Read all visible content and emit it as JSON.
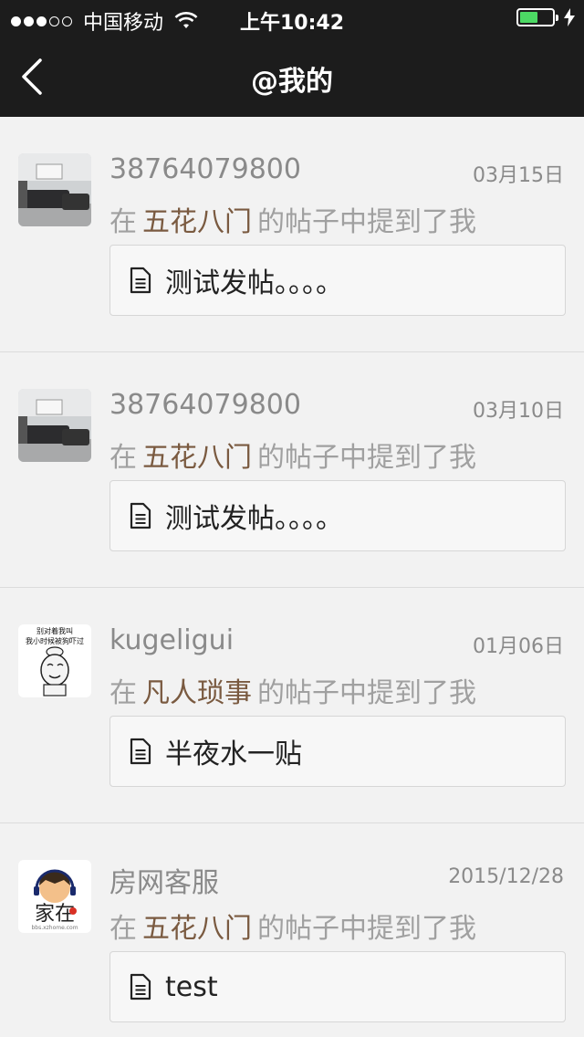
{
  "status": {
    "carrier": "中国移动",
    "time": "上午10:42",
    "signal_filled": 3,
    "signal_total": 5,
    "battery_level": 0.55,
    "battery_color": "#4cd964"
  },
  "nav": {
    "title": "@我的",
    "back_icon": "chevron-left-icon"
  },
  "mention_text": {
    "prefix": "在",
    "suffix": "的帖子中提到了我"
  },
  "colors": {
    "header_bg": "#1c1c1c",
    "page_bg": "#f2f2f2",
    "board_name": "#7a5a40",
    "muted_text": "#8a8a8a"
  },
  "items": [
    {
      "username": "38764079800",
      "date": "03月15日",
      "board": "五花八门",
      "post_title": "测试发帖。。。。",
      "avatar": "living-room-photo"
    },
    {
      "username": "38764079800",
      "date": "03月10日",
      "board": "五花八门",
      "post_title": "测试发帖。。。。",
      "avatar": "living-room-photo"
    },
    {
      "username": "kugeligui",
      "date": "01月06日",
      "board": "凡人琐事",
      "post_title": "半夜水一贴",
      "avatar": "meme-face",
      "avatar_caption_1": "别对着我叫",
      "avatar_caption_2": "我小时候被狗吓过"
    },
    {
      "username": "房网客服",
      "date": "2015/12/28",
      "board": "五花八门",
      "post_title": "test",
      "avatar": "support-agent-logo",
      "avatar_caption_1": "家在",
      "avatar_caption_2": "bbs.xzhome.com"
    }
  ]
}
